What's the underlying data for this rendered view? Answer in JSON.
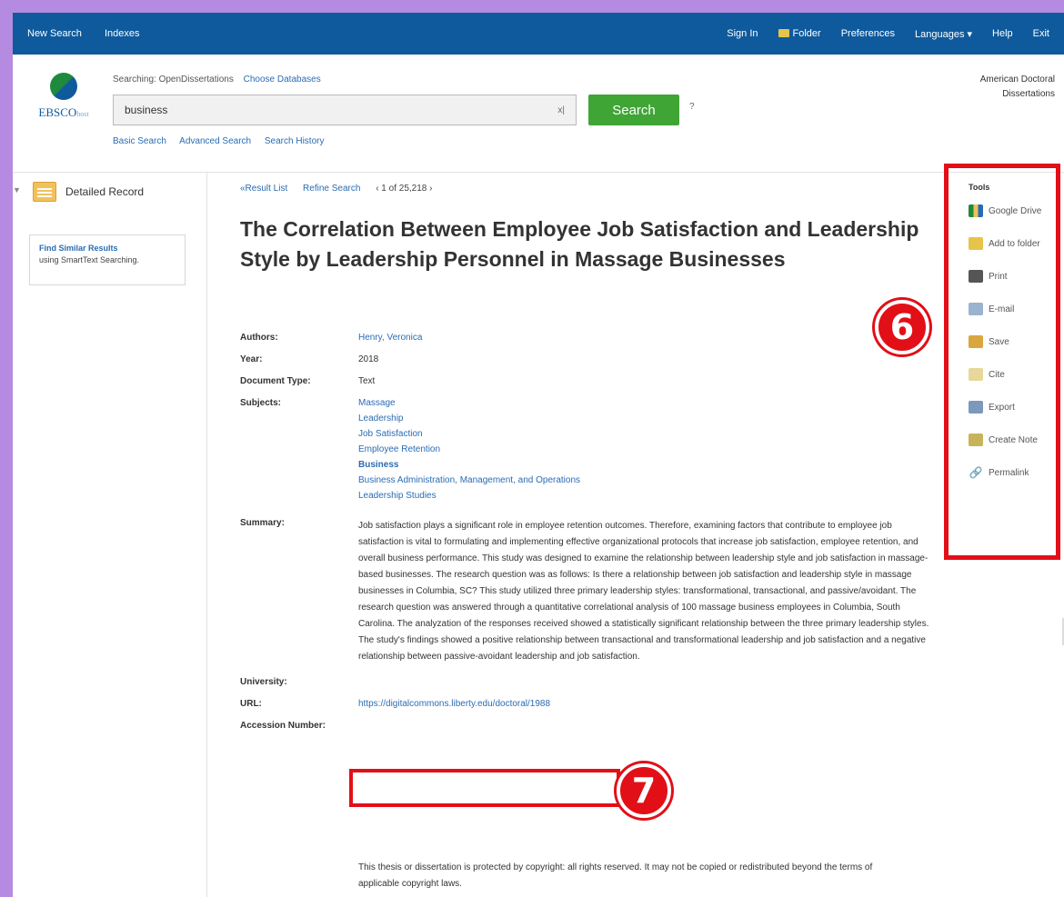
{
  "topnav": {
    "left": [
      "New Search",
      "Indexes"
    ],
    "right": [
      "Sign In",
      "Folder",
      "Preferences",
      "Languages ▾",
      "Help",
      "Exit"
    ]
  },
  "header": {
    "logo_text": "EBSCO",
    "logo_sub": "host",
    "searching_label": "Searching: OpenDissertations",
    "choose_databases": "Choose Databases",
    "search_value": "business",
    "clear_label": "x|",
    "search_button": "Search",
    "help": "?",
    "sublinks": [
      "Basic Search",
      "Advanced Search",
      "Search History"
    ],
    "right_line1": "American Doctoral",
    "right_line2": "Dissertations"
  },
  "left": {
    "detailed_record": "Detailed Record",
    "find_similar_title": "Find Similar Results",
    "find_similar_sub": "using SmartText Searching."
  },
  "main": {
    "crumbs": [
      "«Result List",
      "Refine Search"
    ],
    "count": "‹ 1 of 25,218 ›",
    "title": "The Correlation Between Employee Job Satisfaction and Leadership Style by Leadership Personnel in Massage Businesses",
    "fields": {
      "authors_label": "Authors:",
      "authors": "Henry, Veronica",
      "year_label": "Year:",
      "year": "2018",
      "doctype_label": "Document Type:",
      "doctype": "Text",
      "subjects_label": "Subjects:",
      "subjects": [
        "Massage",
        "Leadership",
        "Job Satisfaction",
        "Employee Retention",
        "Business",
        "Business Administration, Management, and Operations",
        "Leadership Studies"
      ],
      "summary_label": "Summary:",
      "summary": "Job satisfaction plays a significant role in employee retention outcomes. Therefore, examining factors that contribute to employee job satisfaction is vital to formulating and implementing effective organizational protocols that increase job satisfaction, employee retention, and overall business performance. This study was designed to examine the relationship between leadership style and job satisfaction in massage-based businesses. The research question was as follows: Is there a relationship between job satisfaction and leadership style in massage businesses in Columbia, SC? This study utilized three primary leadership styles: transformational, transactional, and passive/avoidant. The research question was answered through a quantitative correlational analysis of 100 massage business employees in Columbia, South Carolina. The analyzation of the responses received showed a statistically significant relationship between the three primary leadership styles. The study's findings showed a positive relationship between transactional and transformational leadership and job satisfaction and a negative relationship between passive-avoidant leadership and job satisfaction.",
      "university_label": "University:",
      "url_label": "URL:",
      "url": "https://digitalcommons.liberty.edu/doctoral/1988",
      "accession_label": "Accession Number:",
      "copyright": "This thesis or dissertation is protected by copyright: all rights reserved. It may not be copied or redistributed beyond the terms of applicable copyright laws."
    }
  },
  "tools": {
    "heading": "Tools",
    "items": [
      {
        "label": "Google Drive",
        "icon": "google-drive-icon"
      },
      {
        "label": "Add to folder",
        "icon": "folder-icon"
      },
      {
        "label": "Print",
        "icon": "print-icon"
      },
      {
        "label": "E-mail",
        "icon": "email-icon"
      },
      {
        "label": "Save",
        "icon": "save-icon"
      },
      {
        "label": "Cite",
        "icon": "cite-icon"
      },
      {
        "label": "Export",
        "icon": "export-icon"
      },
      {
        "label": "Create Note",
        "icon": "note-icon"
      },
      {
        "label": "Permalink",
        "icon": "link-icon"
      }
    ]
  },
  "annotations": {
    "badge_tools": "6",
    "badge_url": "7"
  },
  "colors": {
    "nav": "#0f5a9c",
    "search_button": "#3fa535",
    "highlight": "#e20f17",
    "background": "#b48be0"
  }
}
